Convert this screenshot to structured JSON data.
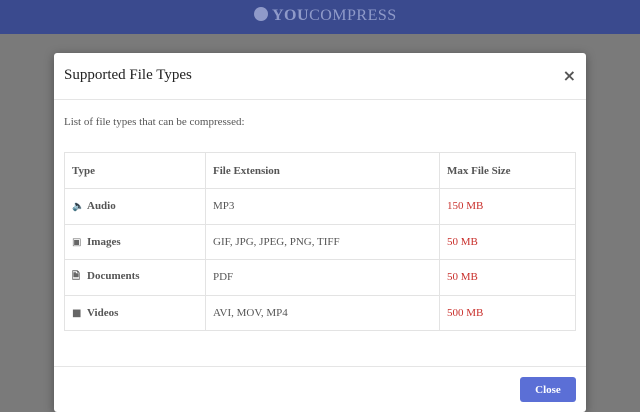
{
  "header": {
    "logo_you": "YOU",
    "logo_compress": "COMPRESS"
  },
  "modal": {
    "title": "Supported File Types",
    "close_symbol": "×",
    "intro": "List of file types that can be compressed:",
    "columns": [
      "Type",
      "File Extension",
      "Max File Size"
    ],
    "rows": [
      {
        "icon": "speaker-icon",
        "icon_glyph": "🔈",
        "type": "Audio",
        "extensions": "MP3",
        "max_size": "150 MB"
      },
      {
        "icon": "image-icon",
        "icon_glyph": "▣",
        "type": "Images",
        "extensions": "GIF, JPG, JPEG, PNG, TIFF",
        "max_size": "50 MB"
      },
      {
        "icon": "document-icon",
        "icon_glyph": "🗎",
        "type": "Documents",
        "extensions": "PDF",
        "max_size": "50 MB"
      },
      {
        "icon": "video-camera-icon",
        "icon_glyph": "■",
        "type": "Videos",
        "extensions": "AVI, MOV, MP4",
        "max_size": "500 MB"
      }
    ],
    "close_button_label": "Close"
  },
  "colors": {
    "header_bg": "#3a4a8e",
    "accent_button": "#5b6fd6",
    "size_text": "#c9302c",
    "overlay": "#7a7a7a"
  }
}
